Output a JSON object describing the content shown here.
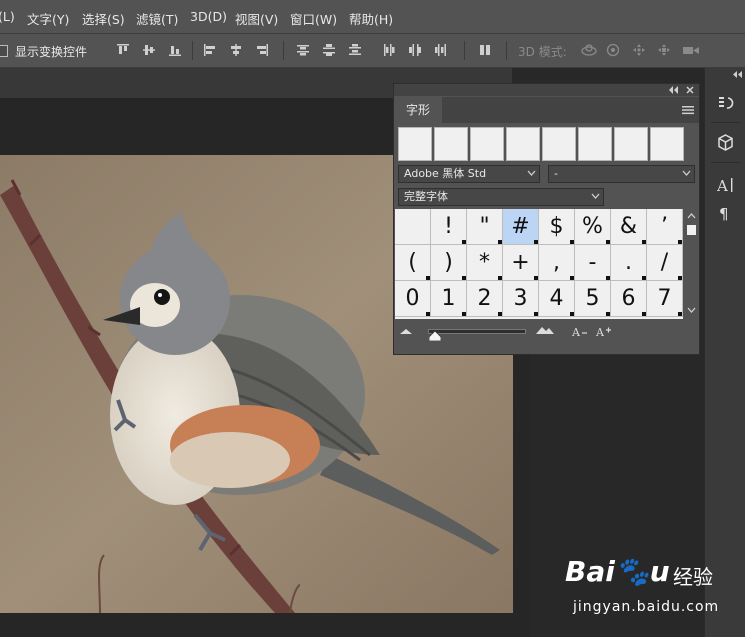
{
  "menubar": {
    "items": [
      {
        "label": "(L)"
      },
      {
        "label": "文字(Y)"
      },
      {
        "label": "选择(S)"
      },
      {
        "label": "滤镜(T)"
      },
      {
        "label": "3D(D)"
      },
      {
        "label": "视图(V)"
      },
      {
        "label": "窗口(W)"
      },
      {
        "label": "帮助(H)"
      }
    ]
  },
  "options_bar": {
    "show_transform_controls": "显示变换控件",
    "mode_3d": "3D 模式:"
  },
  "glyph_panel": {
    "tab_label": "字形",
    "font_family": "Adobe 黑体 Std",
    "font_style": "-",
    "glyph_set": "完整字体",
    "selected_glyph": "#",
    "glyphs": [
      "",
      "!",
      "\"",
      "#",
      "$",
      "%",
      "&",
      "’",
      "(",
      ")",
      "*",
      "+",
      ",",
      "-",
      ".",
      "/",
      "0",
      "1",
      "2",
      "3",
      "4",
      "5",
      "6",
      "7"
    ]
  },
  "watermark": {
    "brand": "Bai🐾u",
    "suffix": "经验",
    "url": "jingyan.baidu.com"
  },
  "colors": {
    "menubar_bg": "#535353",
    "workspace_bg": "#282828",
    "glyph_selected": "#bcd5f5"
  }
}
